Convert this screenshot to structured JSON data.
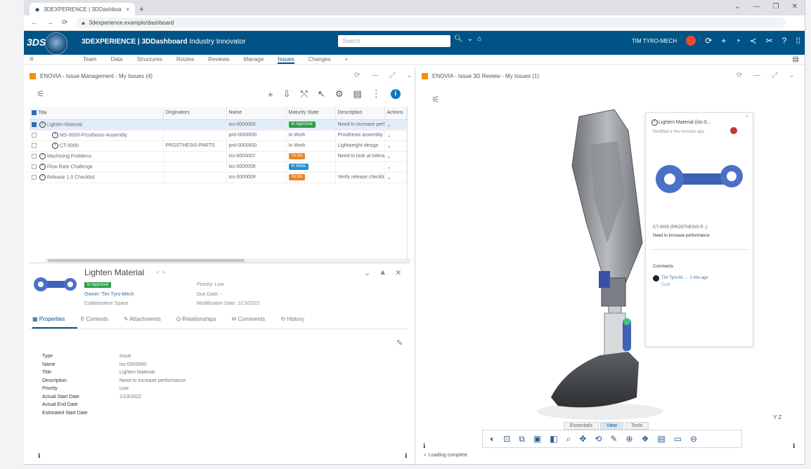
{
  "browser": {
    "tab_title": "3DEXPERIENCE | 3DDashboard",
    "tab_close": "×",
    "new_tab": "+",
    "url": "3dexperience.example/dashboard",
    "nav": [
      "←",
      "→",
      "⟳"
    ],
    "window_controls": [
      "⌄",
      "—",
      "❐",
      "✕"
    ]
  },
  "topbar": {
    "brand": "3DS",
    "title_bold": "3DEXPERIENCE | 3DDashboard",
    "title_rest": " Industry Innovator",
    "search_placeholder": "Search",
    "user_name": "TIM TYRO-MECH",
    "icons": [
      "share-icon",
      "add-icon",
      "share-network-icon",
      "tag-icon",
      "help-icon",
      "grid-icon"
    ]
  },
  "menu": {
    "items": [
      "Team",
      "Data",
      "Structures",
      "Routes",
      "Reviews",
      "Manage",
      "Issues",
      "Changes"
    ],
    "active": "Issues",
    "add": "+"
  },
  "left_panel": {
    "header": "ENOVIA - Issue Management - My Issues (4)",
    "columns": [
      "Title",
      "Originators",
      "Name",
      "Maturity State",
      "Description",
      "Actions"
    ],
    "rows": [
      {
        "title": "Lighten Material",
        "originators": "",
        "name": "iss-0000000",
        "state": "In Approval",
        "state_color": "#2e9f47",
        "description": "Need to increase perf...",
        "level": 0,
        "selected": true
      },
      {
        "title": "MS-0000-Prosthesis-Assembly",
        "originators": "",
        "name": "prd-0000000",
        "state": "In Work",
        "state_color": "",
        "description": "Prosthesis assembly ...",
        "level": 1,
        "selected": false
      },
      {
        "title": "CT-0000",
        "originators": "PROSTHESIS-PARTS",
        "name": "prd-0000000",
        "state": "In Work",
        "state_color": "",
        "description": "Lightweight design",
        "level": 1,
        "selected": false
      },
      {
        "title": "Machining Problems",
        "originators": "",
        "name": "iss-0000007",
        "state": "To Do",
        "state_color": "#e8862a",
        "description": "Need to look at tolera...",
        "level": 0,
        "selected": false
      },
      {
        "title": "Flow Rate Challenge",
        "originators": "",
        "name": "iss-0000008",
        "state": "In Work",
        "state_color": "#1f8fd6",
        "description": "",
        "level": 0,
        "selected": false
      },
      {
        "title": "Release 1.0 Checklist",
        "originators": "",
        "name": "iss-0000009",
        "state": "To Do",
        "state_color": "#e8862a",
        "description": "Verify release checklist",
        "level": 0,
        "selected": false
      }
    ],
    "detail": {
      "title": "Lighten Material",
      "nav": "< >",
      "state": "In Approval",
      "owner_line": "Owner: Tim Tyro-Mech",
      "space": "Collaborative Space",
      "priority": "Priority: Low",
      "due": "Due Date: -",
      "modified": "Modification Date: 1/13/2022",
      "tabs": [
        "Properties",
        "Contexts",
        "Attachments",
        "Relationships",
        "Comments",
        "History"
      ],
      "properties": [
        {
          "label": "Type",
          "value": "Issue"
        },
        {
          "label": "Name",
          "value": "iss-0000000"
        },
        {
          "label": "Title",
          "value": "Lighten Material"
        },
        {
          "label": "Description",
          "value": "Need to increase performance"
        },
        {
          "label": "Priority",
          "value": "Low"
        },
        {
          "label": "Actual Start Date",
          "value": "1/13/2022"
        },
        {
          "label": "Actual End Date",
          "value": ""
        },
        {
          "label": "Estimated Start Date",
          "value": ""
        }
      ]
    }
  },
  "right_panel": {
    "header": "ENOVIA - Issue 3D Review - My Issues (1)",
    "card": {
      "title": "Lighten Material (iss-0...",
      "subtitle": "Modified a few minutes ago",
      "part_label": "CT-0000 (PROSTHESIS-P...)",
      "part_desc": "Need to increase performance",
      "activity": "Comments",
      "comment_user": "Tim Tyro-M... · 1 min ago",
      "comment": "Cool",
      "close": "×"
    },
    "view_tabs": [
      "Essentials",
      "View",
      "Tools"
    ],
    "active_view_tab": "View",
    "status": "Loading complete",
    "axis": "Y  Z"
  },
  "colors": {
    "brand": "#005386",
    "accent": "#f29200",
    "approved": "#2e9f47",
    "todo": "#e8862a",
    "inwork": "#1f8fd6"
  }
}
